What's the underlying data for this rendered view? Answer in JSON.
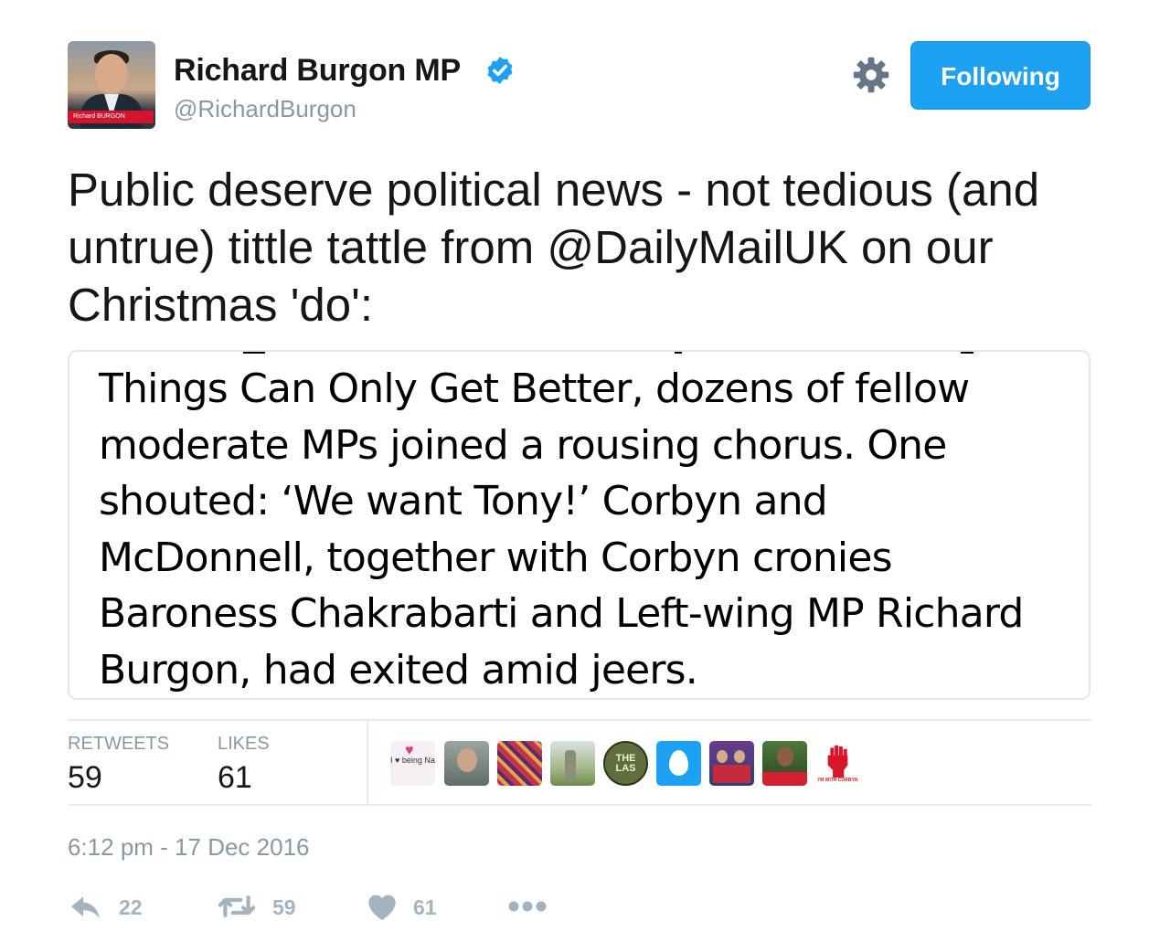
{
  "author": {
    "display_name": "Richard Burgon MP",
    "handle": "@RichardBurgon",
    "verified": true,
    "avatar_banner_text": "Richard BURGON"
  },
  "follow_button": {
    "label": "Following"
  },
  "settings": {
    "icon": "gear-icon"
  },
  "tweet": {
    "text_before": "Public deserve political news - not tedious (and untrue) tittle tattle from ",
    "mention": "@DailyMailUK",
    "text_after": " on our Christmas 'do':"
  },
  "media": {
    "lines": [
      "Things Can Only Get Better, dozens of fellow",
      "moderate MPs joined a rousing chorus. One",
      "shouted: ‘We want Tony!’ Corbyn and",
      "McDonnell, together with Corbyn cronies",
      "Baroness Chakrabarti and Left-wing MP Richard",
      "Burgon, had exited amid jeers."
    ]
  },
  "stats": {
    "retweets_label": "RETWEETS",
    "retweets": "59",
    "likes_label": "LIKES",
    "likes": "61"
  },
  "likers": [
    {
      "name": "liker-1",
      "avatar_text": "I ♥ being Nana",
      "color": "#f3e6ef"
    },
    {
      "name": "liker-2",
      "color": "#7c8a7e"
    },
    {
      "name": "liker-3",
      "color": "#b8344c"
    },
    {
      "name": "liker-4",
      "color": "#8aa36a"
    },
    {
      "name": "liker-5",
      "avatar_text": "THE LAS",
      "color": "#5c6b3c"
    },
    {
      "name": "liker-6",
      "color": "#1da1f2"
    },
    {
      "name": "liker-7",
      "color": "#3b4f8c"
    },
    {
      "name": "liker-8",
      "color": "#3c5f2e"
    },
    {
      "name": "liker-9",
      "avatar_text": "I'M WITH CORBYN",
      "color": "#d7162b"
    }
  ],
  "timestamp": "6:12 pm - 17 Dec 2016",
  "actions": {
    "reply_count": "22",
    "retweet_count": "59",
    "like_count": "61"
  },
  "colors": {
    "accent": "#1da1f2",
    "muted_text": "#8899a6",
    "divider": "#e6ecf0"
  }
}
